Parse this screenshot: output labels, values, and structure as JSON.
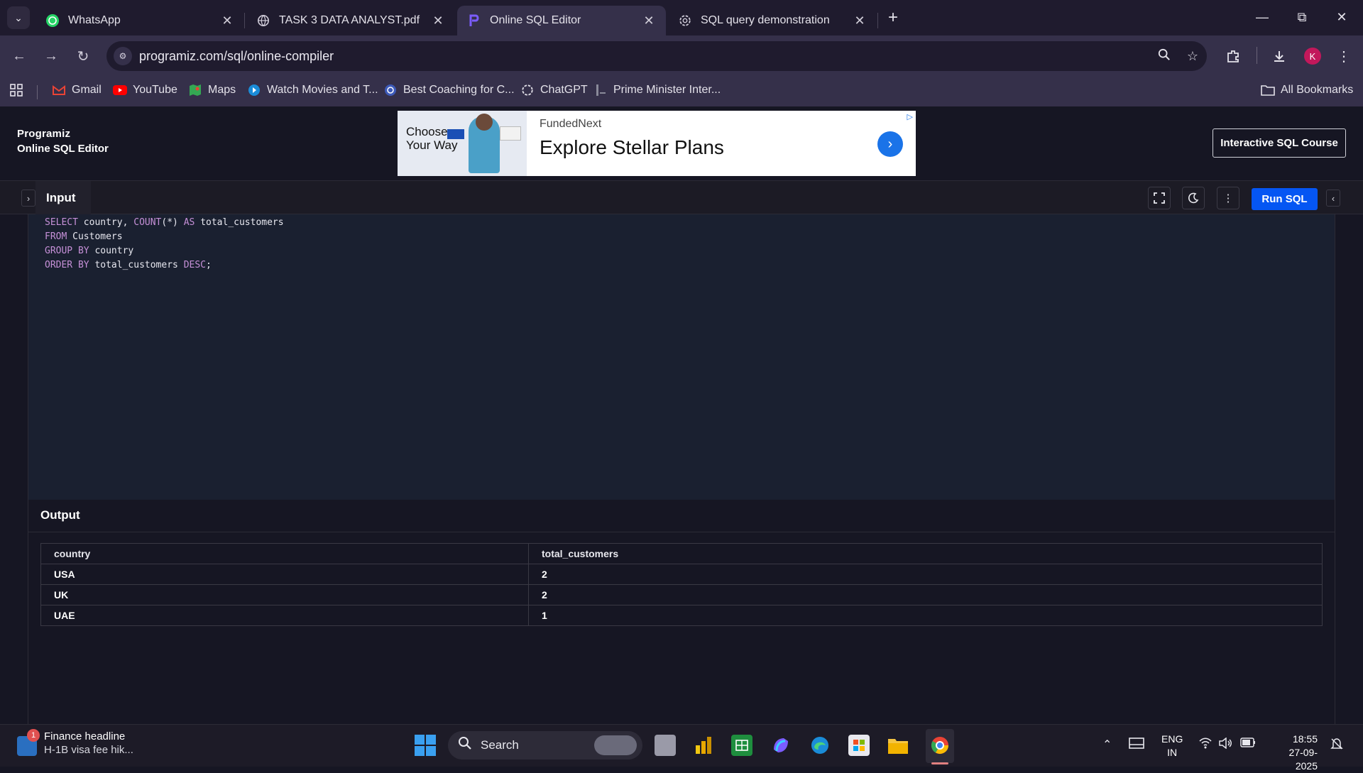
{
  "browser": {
    "tabs": [
      {
        "title": "WhatsApp",
        "icon": "whatsapp-icon",
        "active": false
      },
      {
        "title": "TASK 3 DATA ANALYST.pdf",
        "icon": "globe-icon",
        "active": false
      },
      {
        "title": "Online SQL Editor",
        "icon": "programiz-icon",
        "active": true
      },
      {
        "title": "SQL query demonstration",
        "icon": "chatgpt-icon",
        "active": false
      }
    ],
    "url": "programiz.com/sql/online-compiler",
    "avatar_letter": "K",
    "bookmarks": [
      {
        "label": "Gmail",
        "icon": "gmail-icon"
      },
      {
        "label": "YouTube",
        "icon": "youtube-icon"
      },
      {
        "label": "Maps",
        "icon": "maps-icon"
      },
      {
        "label": "Watch Movies and T...",
        "icon": "movie-icon"
      },
      {
        "label": "Best Coaching for C...",
        "icon": "coaching-icon"
      },
      {
        "label": "ChatGPT",
        "icon": "chatgpt-icon"
      },
      {
        "label": "Prime Minister Inter...",
        "icon": "pm-icon"
      }
    ],
    "all_bookmarks": "All Bookmarks"
  },
  "site": {
    "logo": "Programiz",
    "subtitle": "Online SQL Editor",
    "course_button": "Interactive SQL Course"
  },
  "ad": {
    "image_text_line1": "Choose",
    "image_text_line2": "Your Way",
    "brand": "FundedNext",
    "headline": "Explore Stellar Plans"
  },
  "editor": {
    "tab_label": "Input",
    "run_label": "Run SQL",
    "code_lines": [
      [
        {
          "t": "SELECT ",
          "c": "kw"
        },
        {
          "t": "country, ",
          "c": "id"
        },
        {
          "t": "COUNT",
          "c": "kw"
        },
        {
          "t": "(*) ",
          "c": "pn"
        },
        {
          "t": "AS ",
          "c": "kw"
        },
        {
          "t": "total_customers",
          "c": "id"
        }
      ],
      [
        {
          "t": "FROM ",
          "c": "kw"
        },
        {
          "t": "Customers",
          "c": "id"
        }
      ],
      [
        {
          "t": "GROUP BY ",
          "c": "kw"
        },
        {
          "t": "country",
          "c": "id"
        }
      ],
      [
        {
          "t": "ORDER BY ",
          "c": "kw"
        },
        {
          "t": "total_customers ",
          "c": "id"
        },
        {
          "t": "DESC",
          "c": "kw"
        },
        {
          "t": ";",
          "c": "pn"
        }
      ]
    ]
  },
  "output": {
    "title": "Output",
    "columns": [
      "country",
      "total_customers"
    ],
    "rows": [
      [
        "USA",
        "2"
      ],
      [
        "UK",
        "2"
      ],
      [
        "UAE",
        "1"
      ]
    ]
  },
  "taskbar": {
    "news_title": "Finance headline",
    "news_sub": "H-1B visa fee hik...",
    "news_badge": "1",
    "search_label": "Search",
    "lang_line1": "ENG",
    "lang_line2": "IN",
    "time": "18:55",
    "date": "27-09-2025"
  },
  "colors": {
    "accent_run": "#0556f3",
    "code_keyword": "#c690d8",
    "code_bg": "#1a2030"
  }
}
